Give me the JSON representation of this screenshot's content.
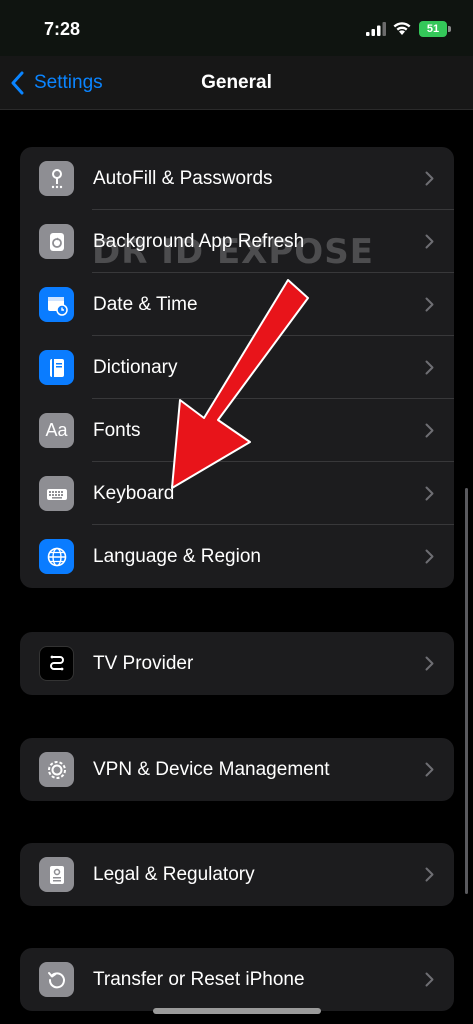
{
  "status": {
    "time": "7:28",
    "battery": "51"
  },
  "nav": {
    "back_label": "Settings",
    "title": "General"
  },
  "groups": [
    {
      "items": [
        {
          "label": "AutoFill & Passwords",
          "icon": "key-icon",
          "color": "#8e8e93"
        },
        {
          "label": "Background App Refresh",
          "icon": "refresh-icon",
          "color": "#8e8e93"
        },
        {
          "label": "Date & Time",
          "icon": "calendar-clock-icon",
          "color": "#0a7cff"
        },
        {
          "label": "Dictionary",
          "icon": "book-icon",
          "color": "#0a7cff"
        },
        {
          "label": "Fonts",
          "icon": "fonts-icon",
          "color": "#8e8e93",
          "glyph": "Aa"
        },
        {
          "label": "Keyboard",
          "icon": "keyboard-icon",
          "color": "#8e8e93"
        },
        {
          "label": "Language & Region",
          "icon": "globe-icon",
          "color": "#0a7cff"
        }
      ]
    },
    {
      "items": [
        {
          "label": "TV Provider",
          "icon": "tv-provider-icon",
          "color": "#000000"
        }
      ]
    },
    {
      "items": [
        {
          "label": "VPN & Device Management",
          "icon": "gear-icon",
          "color": "#8e8e93"
        }
      ]
    },
    {
      "items": [
        {
          "label": "Legal & Regulatory",
          "icon": "document-icon",
          "color": "#8e8e93"
        }
      ]
    },
    {
      "items": [
        {
          "label": "Transfer or Reset iPhone",
          "icon": "reset-icon",
          "color": "#8e8e93"
        }
      ]
    }
  ],
  "watermark": "DR ID EXPOSE",
  "colors": {
    "accent": "#0a84ff",
    "arrow": "#e8141a",
    "battery": "#34c759"
  }
}
